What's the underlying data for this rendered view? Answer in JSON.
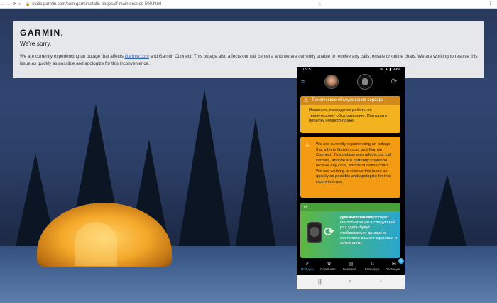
{
  "browser": {
    "url": "static.garmin.com/com.garmin.static-pages/cf-maintenance-500.html",
    "back_icon": "arrow-left-icon",
    "forward_icon": "arrow-right-icon",
    "reload_icon": "reload-icon",
    "home_icon": "home-icon"
  },
  "card": {
    "logo": "GARMIN.",
    "heading": "We're sorry.",
    "message_part1": "We are currently experiencing an outage that affects ",
    "message_link": "Garmin.com",
    "message_part2": " and Garmin Connect. This outage also affects our call centers, and we are currently unable to receive any calls, emails or online chats. We are working to resolve this issue as quickly as possible and apologize for this inconvenience."
  },
  "phone": {
    "time": "09:57",
    "battery": "99%",
    "warning": {
      "title": "Техническое обслуживание сервера",
      "body": "Извините, проводятся работы по техническому обслуживанию. Повторите попытку немного позже."
    },
    "outage": {
      "body": "We are currently experiencing an outage that affects Garmin.com and Garmin Connect. This outage also affects our call centers, and we are currently unable to receive any calls, emails or online chats. We are working to resolve this issue as quickly as possible and apologize for this inconvenience."
    },
    "nodata": {
      "title": "Данные пока отсутствуют",
      "body": "При выполнении синхронизации в следующий раз здесь будут отображаться данные о состоянии вашего здоровья и активности."
    },
    "tabs": [
      {
        "label": "Мой день",
        "icon": "check-icon"
      },
      {
        "label": "Соревнова...",
        "icon": "trophy-icon"
      },
      {
        "label": "Лента нов...",
        "icon": "newsfeed-icon"
      },
      {
        "label": "Календарь",
        "icon": "calendar-icon"
      },
      {
        "label": "Оповещен...",
        "icon": "inbox-icon"
      }
    ],
    "badge": "1",
    "calendar_day": "31"
  },
  "colors": {
    "warning_header": "#d1891b",
    "warning_body": "#f3b21f",
    "outage_card": "#f39c13",
    "accent_blue": "#3aa6e8"
  }
}
